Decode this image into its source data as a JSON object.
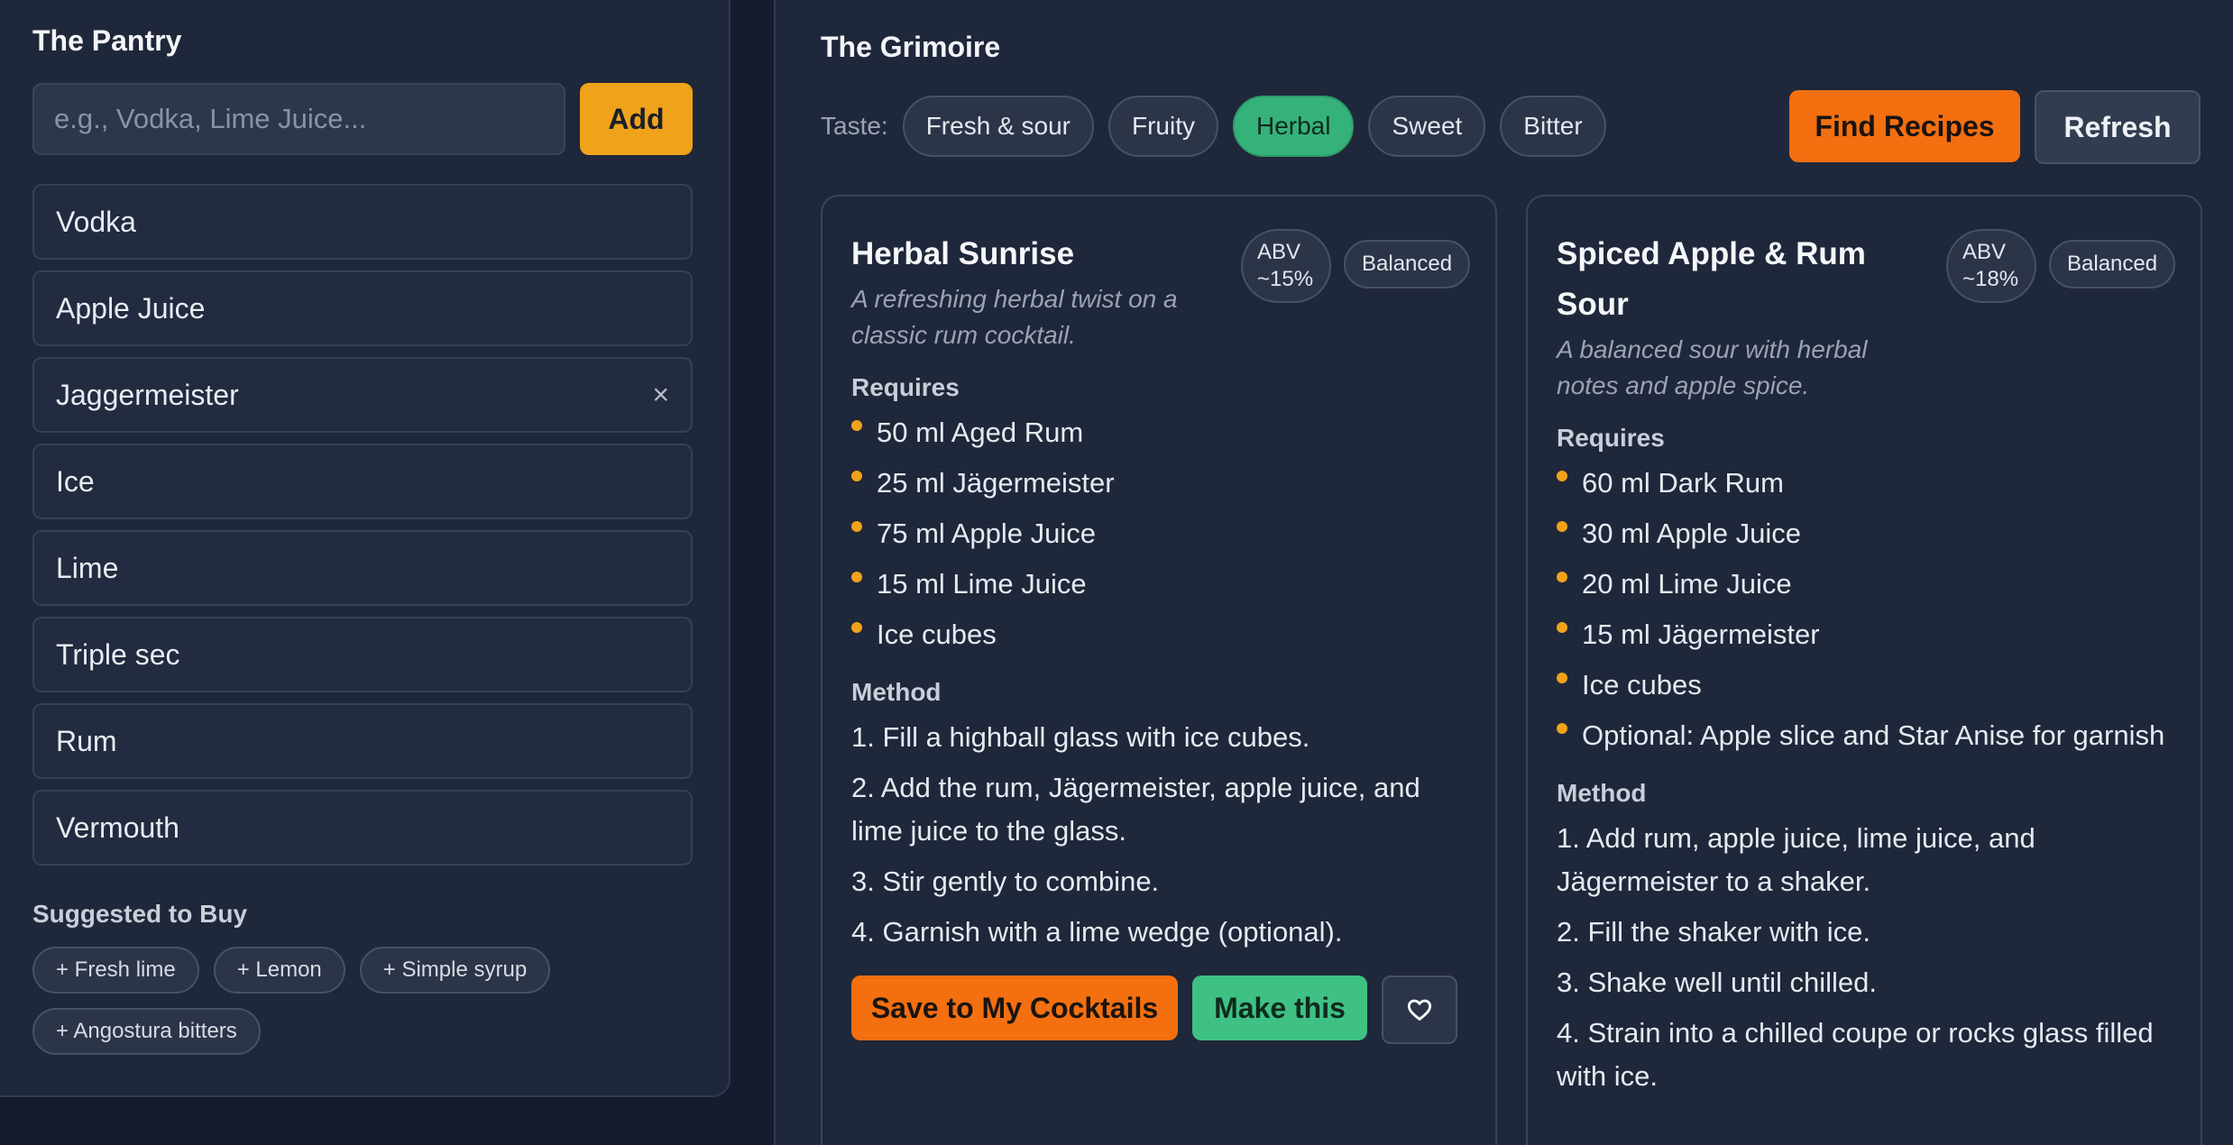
{
  "pantry": {
    "title": "The Pantry",
    "input_placeholder": "e.g., Vodka, Lime Juice...",
    "add_label": "Add",
    "items": [
      {
        "label": "Vodka"
      },
      {
        "label": "Apple Juice"
      },
      {
        "label": "Jaggermeister",
        "remove": "×"
      },
      {
        "label": "Ice"
      },
      {
        "label": "Lime"
      },
      {
        "label": "Triple sec"
      },
      {
        "label": "Rum"
      },
      {
        "label": "Vermouth"
      }
    ],
    "suggested_title": "Suggested to Buy",
    "suggested": [
      "+ Fresh lime",
      "+ Lemon",
      "+ Simple syrup",
      "+ Angostura bitters"
    ]
  },
  "grimoire": {
    "title": "The Grimoire",
    "taste_label": "Taste:",
    "tastes": [
      "Fresh & sour",
      "Fruity",
      "Herbal",
      "Sweet",
      "Bitter"
    ],
    "active_taste": "Herbal",
    "find_label": "Find Recipes",
    "refresh_label": "Refresh"
  },
  "cards": [
    {
      "title": "Herbal Sunrise",
      "description": "A refreshing herbal twist on a classic rum cocktail.",
      "abv_label": "ABV",
      "abv_value": "~15%",
      "balance": "Balanced",
      "requires_title": "Requires",
      "ingredients": [
        "50 ml Aged Rum",
        "25 ml Jägermeister",
        "75 ml Apple Juice",
        "15 ml Lime Juice",
        "Ice cubes"
      ],
      "method_title": "Method",
      "steps": [
        "1. Fill a highball glass with ice cubes.",
        "2. Add the rum, Jägermeister, apple juice, and lime juice to the glass.",
        "3. Stir gently to combine.",
        "4. Garnish with a lime wedge (optional)."
      ],
      "save_label": "Save to My Cocktails",
      "make_label": "Make this"
    },
    {
      "title": "Spiced Apple & Rum Sour",
      "description": "A balanced sour with herbal notes and apple spice.",
      "abv_label": "ABV",
      "abv_value": "~18%",
      "balance": "Balanced",
      "requires_title": "Requires",
      "ingredients": [
        "60 ml Dark Rum",
        "30 ml Apple Juice",
        "20 ml Lime Juice",
        "15 ml Jägermeister",
        "Ice cubes",
        "Optional: Apple slice and Star Anise for garnish"
      ],
      "method_title": "Method",
      "steps": [
        "1. Add rum, apple juice, lime juice, and Jägermeister to a shaker.",
        "2. Fill the shaker with ice.",
        "3. Shake well until chilled.",
        "4. Strain into a chilled coupe or rocks glass filled with ice."
      ]
    }
  ],
  "colors": {
    "accent_orange": "#f36f10",
    "accent_amber": "#f0a31a",
    "accent_green": "#35b27a",
    "panel_bg": "#1f273a",
    "page_bg": "#141c2e"
  },
  "icons": {
    "remove": "close-icon",
    "favorite": "heart-icon",
    "bullet": "dot-icon"
  }
}
